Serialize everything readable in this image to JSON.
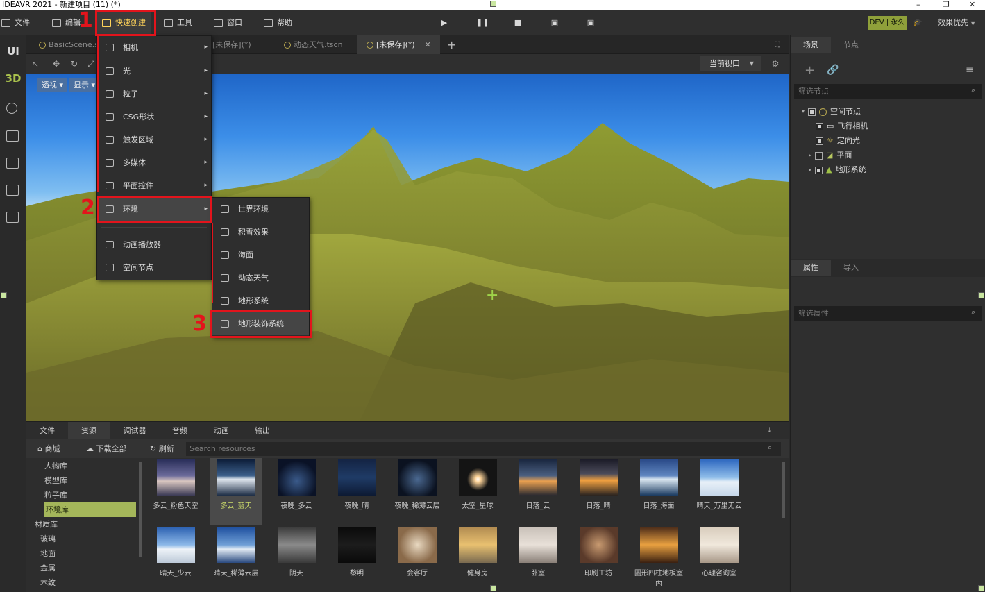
{
  "titlebar": {
    "title": "IDEAVR 2021 - 新建项目 (11) (*)",
    "minimize": "–",
    "maximize": "❐",
    "close": "✕"
  },
  "menubar": {
    "file": "文件",
    "edit": "编辑",
    "quick_create": "快速创建",
    "tools": "工具",
    "window": "窗口",
    "help": "帮助",
    "dev_badge": "DEV | 永久",
    "effect": "效果优先"
  },
  "leftbar": {
    "ui": "UI",
    "threed": "3D"
  },
  "tabs": [
    {
      "label": "BasicScene.s"
    },
    {
      "label": "[未保存](*)"
    },
    {
      "label": "动态天气.tscn"
    },
    {
      "label": "[未保存](*)"
    }
  ],
  "viewport": {
    "perspective": "透视",
    "display": "显示",
    "current_view": "当前视口"
  },
  "quick_menu": [
    {
      "label": "相机"
    },
    {
      "label": "光"
    },
    {
      "label": "粒子"
    },
    {
      "label": "CSG形状"
    },
    {
      "label": "触发区域"
    },
    {
      "label": "多媒体"
    },
    {
      "label": "平面控件"
    },
    {
      "label": "环境"
    },
    {
      "label": "动画播放器"
    },
    {
      "label": "空间节点"
    }
  ],
  "env_submenu": [
    {
      "label": "世界环境"
    },
    {
      "label": "积雪效果"
    },
    {
      "label": "海面"
    },
    {
      "label": "动态天气"
    },
    {
      "label": "地形系统"
    },
    {
      "label": "地形装饰系统"
    }
  ],
  "steps": {
    "s1": "1",
    "s2": "2",
    "s3": "3"
  },
  "scene_panel": {
    "tab_scene": "场景",
    "tab_node": "节点",
    "filter": "筛选节点",
    "nodes": [
      {
        "label": "空间节点"
      },
      {
        "label": "飞行相机"
      },
      {
        "label": "定向光"
      },
      {
        "label": "平面"
      },
      {
        "label": "地形系统"
      }
    ]
  },
  "props_panel": {
    "tab_props": "属性",
    "tab_import": "导入",
    "filter": "筛选属性"
  },
  "bottom": {
    "tabs": [
      "文件",
      "资源",
      "调试器",
      "音频",
      "动画",
      "输出"
    ],
    "shop": "商城",
    "download_all": "下载全部",
    "refresh": "刷新",
    "search_placeholder": "Search resources",
    "libraries": [
      "人物库",
      "模型库",
      "粒子库",
      "环境库",
      "材质库",
      "玻璃",
      "地面",
      "金属",
      "木纹"
    ],
    "assets_row1": [
      "多云_粉色天空",
      "多云_蓝天",
      "夜晚_多云",
      "夜晚_晴",
      "夜晚_稀薄云层",
      "太空_星球",
      "日落_云",
      "日落_晴",
      "日落_海面",
      "晴天_万里无云"
    ],
    "assets_row2": [
      "晴天_少云",
      "晴天_稀薄云层",
      "阴天",
      "黎明",
      "会客厅",
      "健身房",
      "卧室",
      "印刷工坊",
      "圆形四柱地板室",
      "心理咨询室"
    ],
    "asset_row2_overflow": "内"
  }
}
